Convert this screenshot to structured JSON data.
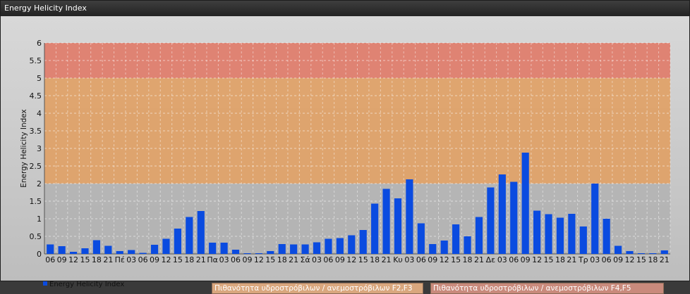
{
  "window": {
    "title": "Energy Helicity Index"
  },
  "legends": {
    "series_label": "Energy Helicity Index",
    "band1_label": "Πιθανότητα υδροστρόβιλων / ανεμοστρόβιλων F2,F3",
    "band2_label": "Πιθανότητα υδροστρόβιλων / ανεμοστρόβιλων F4,F5"
  },
  "colors": {
    "bar": "#0a4be0",
    "band_f2f3": "#d9a77e",
    "band_f4f5": "#c98a7c",
    "band_gray": "#b2b2b2",
    "band_orange": "#e0a064",
    "band_red": "#e07a68"
  },
  "chart_data": {
    "type": "bar",
    "title": "",
    "xlabel": "",
    "ylabel": "Energy Helicity Index",
    "ylim": [
      0,
      6
    ],
    "yticks": [
      "0",
      "0.5",
      "1",
      "1.5",
      "2",
      "2.5",
      "3",
      "3.5",
      "4",
      "4.5",
      "5",
      "5.5",
      "6"
    ],
    "grid": true,
    "legend_position": "bottom-left",
    "bands": [
      {
        "from": 0,
        "to": 2,
        "color": "#b2b2b2"
      },
      {
        "from": 2,
        "to": 5,
        "color": "#e0a064"
      },
      {
        "from": 5,
        "to": 6,
        "color": "#e07a68"
      }
    ],
    "categories": [
      "06",
      "09",
      "12",
      "15",
      "18",
      "21",
      "Πέ",
      "03",
      "06",
      "09",
      "12",
      "15",
      "18",
      "21",
      "Πα",
      "03",
      "06",
      "09",
      "12",
      "15",
      "18",
      "21",
      "Σά",
      "03",
      "06",
      "09",
      "12",
      "15",
      "18",
      "21",
      "Κυ",
      "03",
      "06",
      "09",
      "12",
      "15",
      "18",
      "21",
      "Δε",
      "03",
      "06",
      "09",
      "12",
      "15",
      "18",
      "21",
      "Τρ",
      "03",
      "06",
      "09",
      "12",
      "15",
      "18",
      "21"
    ],
    "series": [
      {
        "name": "Energy Helicity Index",
        "values": [
          0.27,
          0.22,
          0.06,
          0.16,
          0.39,
          0.23,
          0.08,
          0.11,
          0.03,
          0.26,
          0.43,
          0.72,
          1.05,
          1.22,
          0.32,
          0.32,
          0.12,
          0.02,
          0.02,
          0.08,
          0.28,
          0.27,
          0.27,
          0.33,
          0.43,
          0.45,
          0.53,
          0.68,
          1.43,
          1.85,
          1.58,
          2.12,
          0.87,
          0.28,
          0.38,
          0.84,
          0.5,
          1.05,
          1.89,
          2.26,
          2.05,
          2.88,
          1.23,
          1.13,
          1.03,
          1.14,
          0.78,
          2.0,
          1.0,
          0.23,
          0.08,
          0.02,
          0.02,
          0.1
        ]
      }
    ]
  }
}
